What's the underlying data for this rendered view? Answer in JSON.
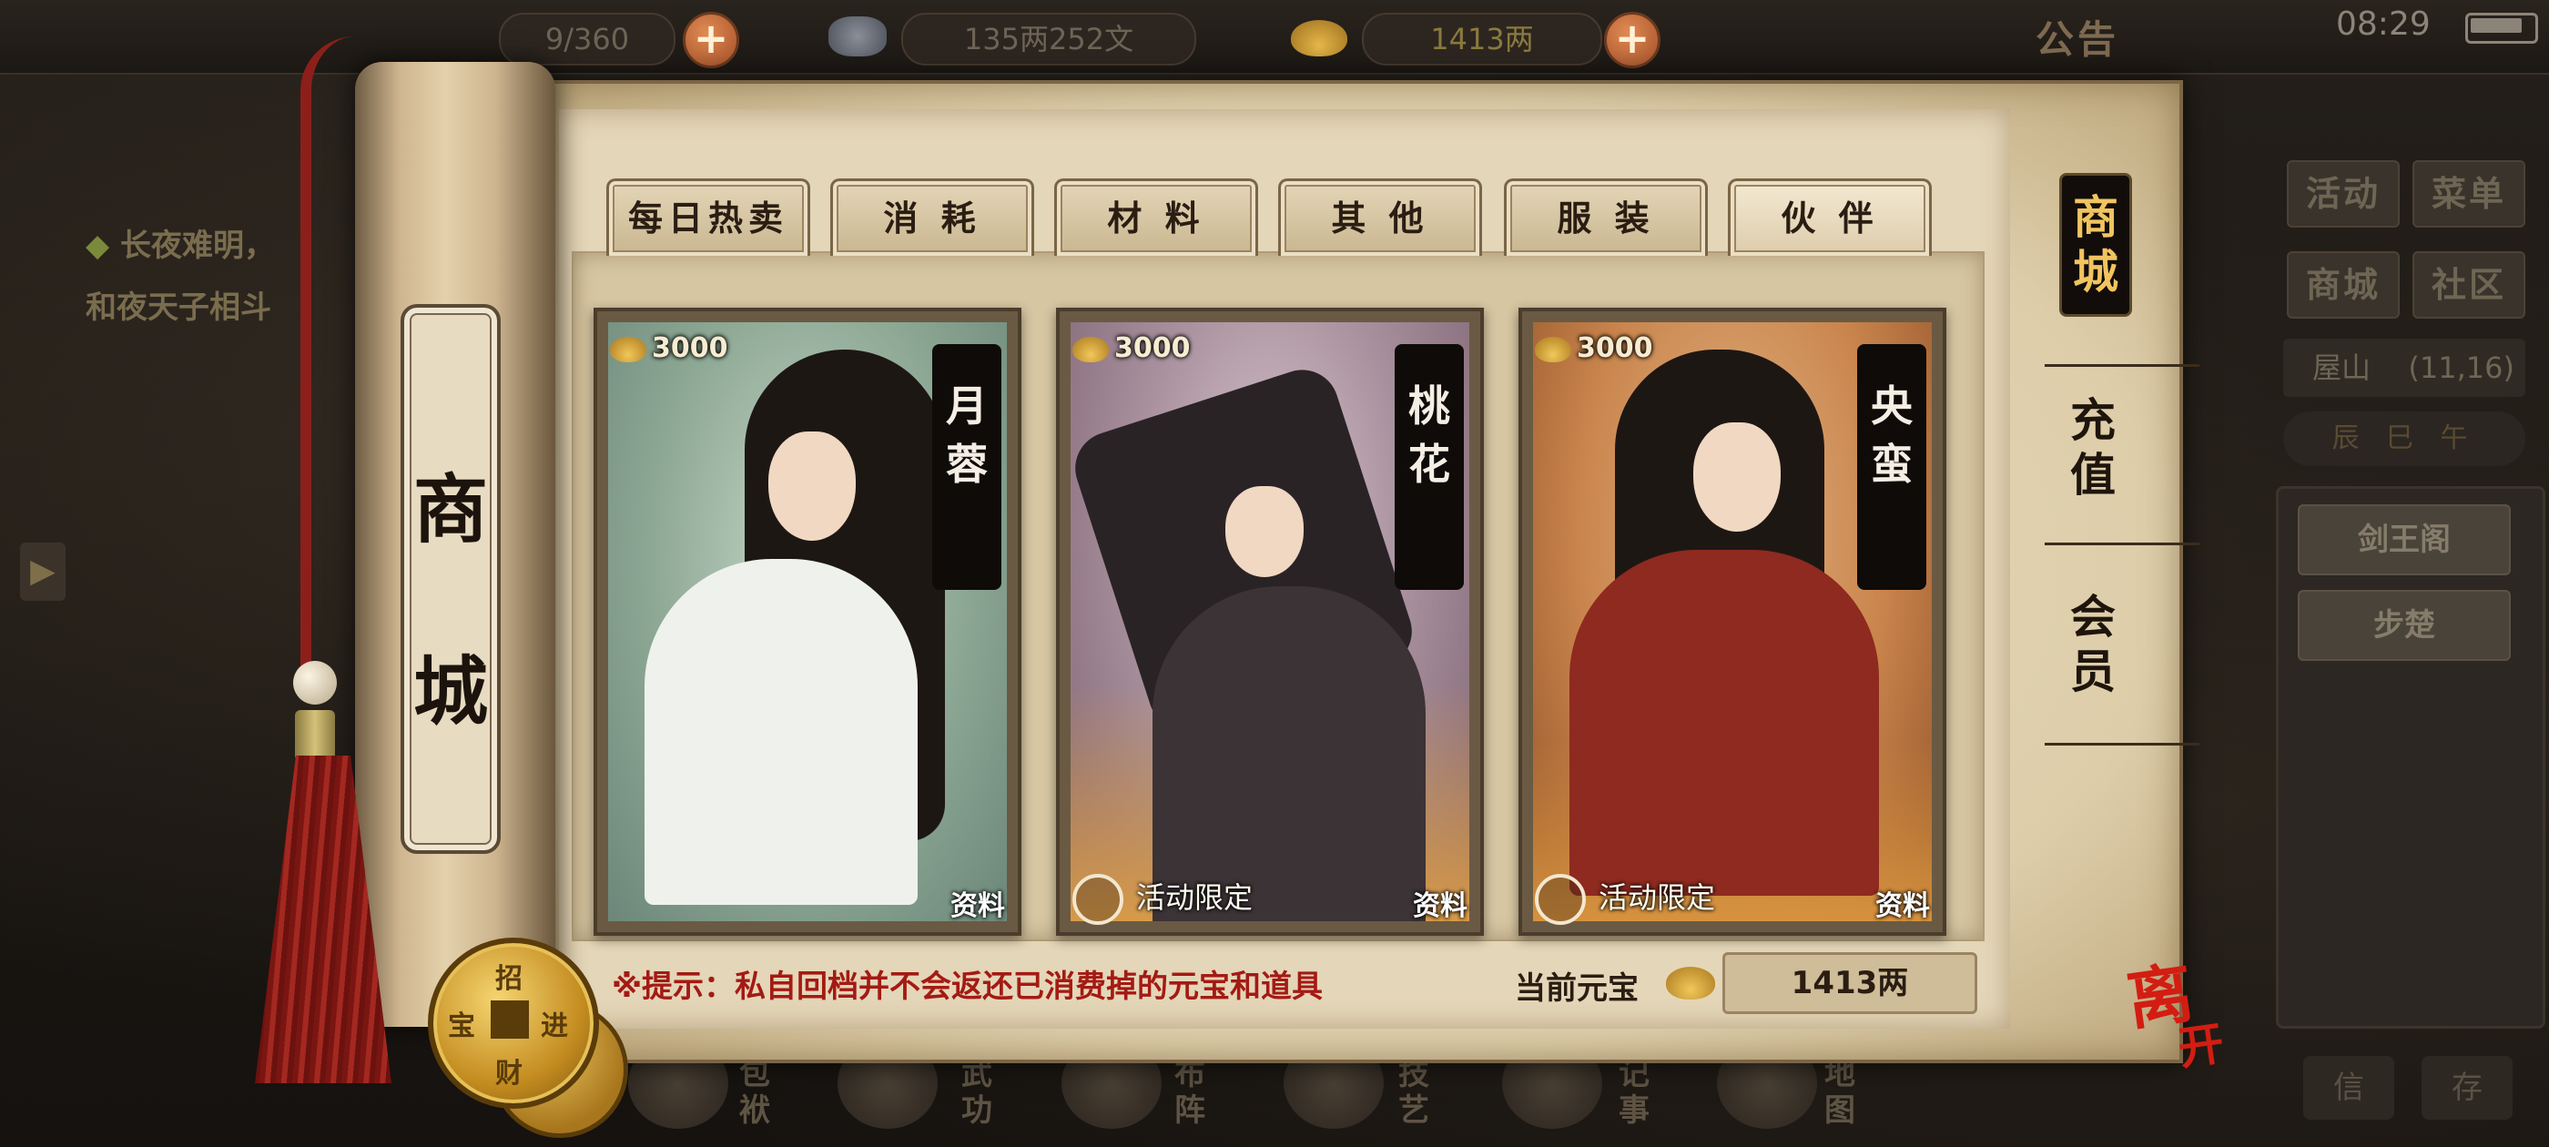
{
  "status_bar": {
    "capacity": "9/360",
    "coins": "135两252文",
    "ingots": "1413两",
    "notice_label": "公告",
    "time": "08:29"
  },
  "quest": {
    "line1": "长夜难明，",
    "line2": "和夜天子相斗"
  },
  "scroll": {
    "title_char1": "商",
    "title_char2": "城"
  },
  "tabs": [
    {
      "label": "每日热卖"
    },
    {
      "label": "消 耗"
    },
    {
      "label": "材 料"
    },
    {
      "label": "其 他"
    },
    {
      "label": "服 装"
    },
    {
      "label": "伙 伴"
    }
  ],
  "cards": [
    {
      "price": "3000",
      "name": "月蓉",
      "info": "资料"
    },
    {
      "price": "3000",
      "name": "桃花",
      "info": "资料",
      "limited": "活动限定"
    },
    {
      "price": "3000",
      "name": "央蛮",
      "info": "资料",
      "limited": "活动限定"
    }
  ],
  "hint": "※提示：私自回档并不会返还已消费掉的元宝和道具",
  "balance": {
    "label": "当前元宝",
    "value": "1413两"
  },
  "side_nav": [
    {
      "label": "商城"
    },
    {
      "label": "充值"
    },
    {
      "label": "会员"
    }
  ],
  "right_menu": {
    "activity": "活动",
    "menu": "菜单",
    "mall": "商城",
    "community": "社区",
    "location": "屋山",
    "coords": "(11,16)",
    "hours": "辰 巳 午",
    "npc1": "剑王阁",
    "npc2": "步楚"
  },
  "bottom_bar": {
    "bag": "包袱",
    "martial": "武功",
    "formation": "布阵",
    "skill": "技艺",
    "diary": "记事",
    "map": "地图",
    "letter": "信",
    "save": "存"
  },
  "coin_button": {
    "chars": [
      "招",
      "财",
      "进",
      "宝"
    ]
  },
  "leave": {
    "main": "离",
    "sub": "开"
  }
}
